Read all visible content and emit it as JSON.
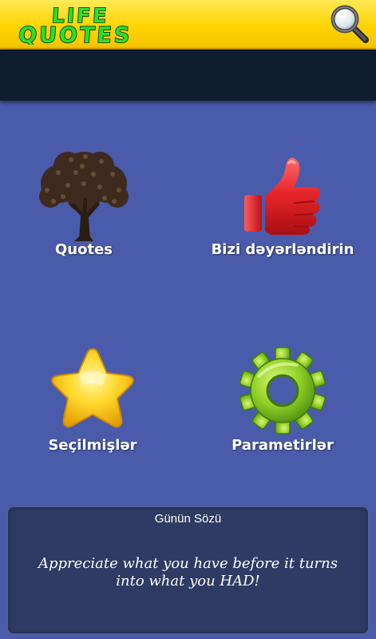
{
  "header": {
    "logo_line1": "LIFE",
    "logo_line2": "QUOTES",
    "search_icon": "magnifier-icon"
  },
  "menu": {
    "items": [
      {
        "label": "Quotes",
        "icon": "tree-icon"
      },
      {
        "label": "Bizi dəyərləndirin",
        "icon": "thumbs-up-icon"
      },
      {
        "label": "Seçilmişlər",
        "icon": "star-icon"
      },
      {
        "label": "Parametirlər",
        "icon": "gear-icon"
      }
    ]
  },
  "quote_of_day": {
    "title": "Günün Sözü",
    "text": "Appreciate what you have before it turns into what you HAD!"
  },
  "colors": {
    "header_yellow": "#ffd400",
    "dark_band": "#0f1d2e",
    "background": "#4a5bab",
    "quote_panel": "#2f3b64"
  }
}
